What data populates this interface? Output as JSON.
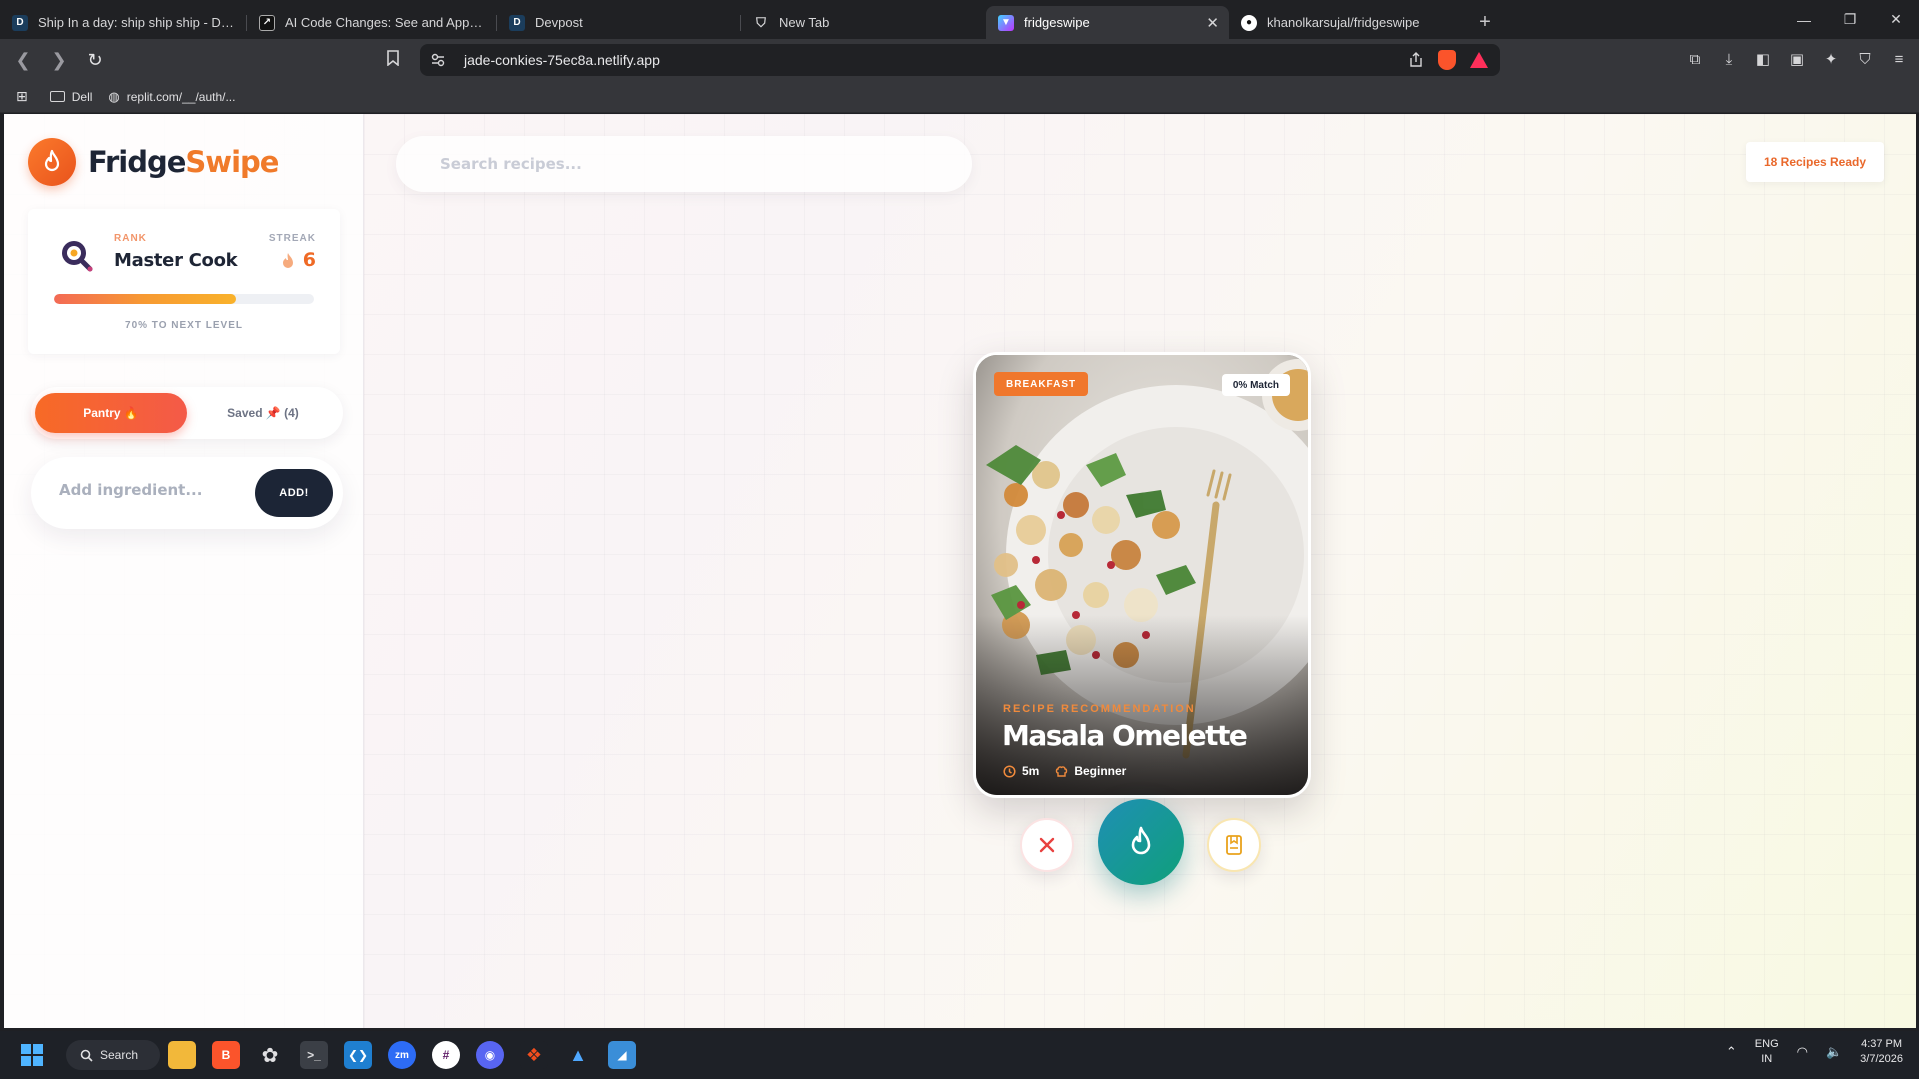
{
  "browser": {
    "tabs": [
      {
        "title": "Ship In a day: ship ship ship - Devpost",
        "favicon": "devpost-icon"
      },
      {
        "title": "AI Code Changes: See and Apply | Go",
        "favicon": "external-icon"
      },
      {
        "title": "Devpost",
        "favicon": "devpost-icon"
      },
      {
        "title": "New Tab",
        "favicon": "shield-icon"
      },
      {
        "title": "fridgeswipe",
        "favicon": "vite-icon",
        "active": true
      },
      {
        "title": "khanolkarsujal/fridgeswipe",
        "favicon": "github-icon"
      }
    ],
    "url": "jade-conkies-75ec8a.netlify.app",
    "bookmarks": [
      {
        "label": "Dell",
        "icon": "folder-icon"
      },
      {
        "label": "replit.com/__/auth/...",
        "icon": "globe-icon"
      }
    ]
  },
  "app": {
    "brand": {
      "name_part1": "Fridge",
      "name_part2": "Swipe"
    },
    "rank_card": {
      "rank_label": "RANK",
      "rank_value": "Master Cook",
      "streak_label": "STREAK",
      "streak_value": "6",
      "progress_percent": 70,
      "progress_text": "70% TO NEXT LEVEL"
    },
    "tabs": {
      "pantry": "Pantry 🔥",
      "saved": "Saved 📌 (4)"
    },
    "add_ingredient": {
      "placeholder": "Add ingredient...",
      "button": "ADD!"
    },
    "search": {
      "placeholder": "Search recipes..."
    },
    "ready_badge": "18 Recipes Ready",
    "card": {
      "category": "BREAKFAST",
      "match": "0% Match",
      "label": "RECIPE RECOMMENDATION",
      "title": "Masala Omelette",
      "time": "5m",
      "difficulty": "Beginner"
    },
    "colors": {
      "accent": "#f0772c",
      "dark": "#1c2536",
      "cook": "#1f8fb5"
    }
  },
  "taskbar": {
    "search": "Search",
    "lang_line1": "ENG",
    "lang_line2": "IN",
    "time": "4:37 PM",
    "date": "3/7/2026"
  }
}
